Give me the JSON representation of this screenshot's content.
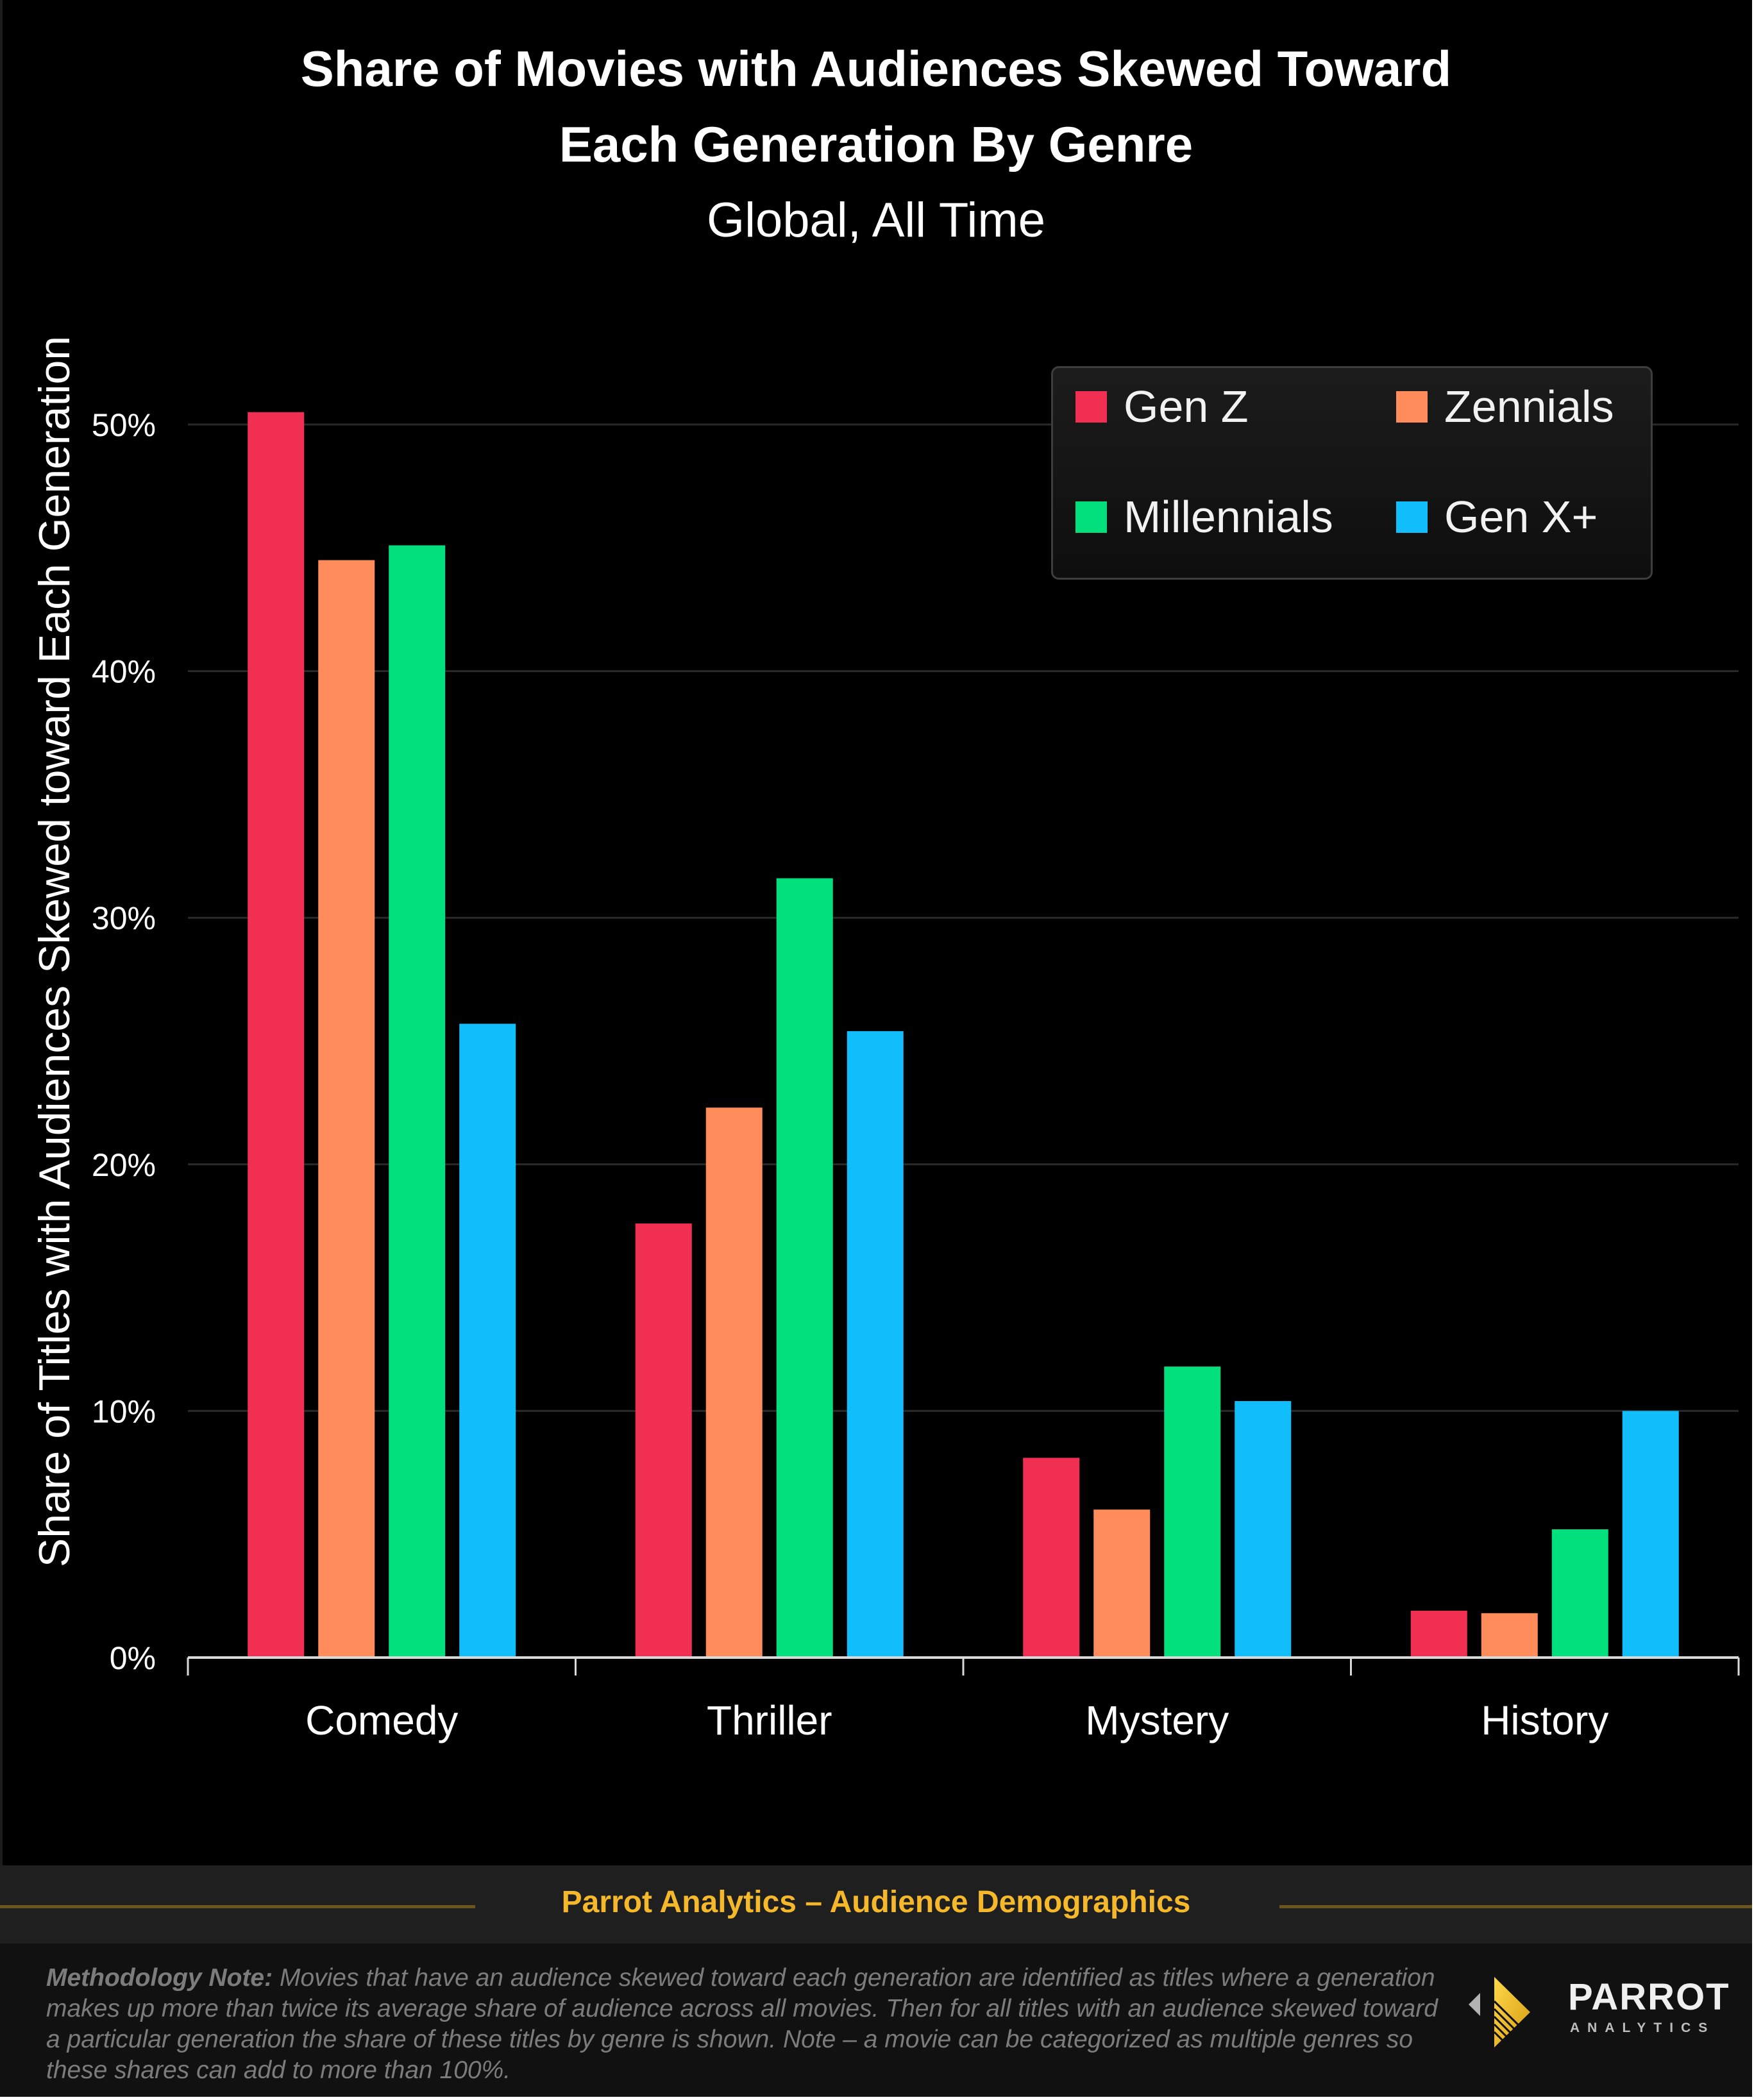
{
  "header": {
    "title_line1": "Share of Movies with Audiences Skewed Toward",
    "title_line2": "Each Generation By Genre",
    "subtitle": "Global, All Time"
  },
  "chart_data": {
    "type": "bar",
    "title": "Share of Movies with Audiences Skewed Toward Each Generation By Genre",
    "subtitle": "Global, All Time",
    "xlabel": "",
    "ylabel": "Share of Titles with Audiences Skewed toward Each Generation",
    "categories": [
      "Comedy",
      "Thriller",
      "Mystery",
      "History"
    ],
    "series": [
      {
        "name": "Gen Z",
        "color": "#f12f53",
        "values": [
          50.5,
          17.6,
          8.1,
          1.9
        ]
      },
      {
        "name": "Zennials",
        "color": "#ff8c5a",
        "values": [
          44.5,
          22.3,
          6.0,
          1.8
        ]
      },
      {
        "name": "Millennials",
        "color": "#02e07e",
        "values": [
          45.1,
          31.6,
          11.8,
          5.2
        ]
      },
      {
        "name": "Gen X+",
        "color": "#12bdfb",
        "values": [
          25.7,
          25.4,
          10.4,
          10.0
        ]
      }
    ],
    "ylim": [
      0,
      50
    ],
    "yticks": [
      0,
      10,
      20,
      30,
      40,
      50
    ],
    "ytick_labels": [
      "0%",
      "10%",
      "20%",
      "30%",
      "40%",
      "50%"
    ],
    "grid": true,
    "legend_position": "top-right",
    "unit": "%"
  },
  "legend": {
    "items": [
      {
        "label": "Gen Z",
        "color": "#f12f53"
      },
      {
        "label": "Zennials",
        "color": "#ff8c5a"
      },
      {
        "label": "Millennials",
        "color": "#02e07e"
      },
      {
        "label": "Gen X+",
        "color": "#12bdfb"
      }
    ]
  },
  "footer": {
    "band_title": "Parrot Analytics – Audience Demographics",
    "method_label": "Methodology Note:",
    "method_text": " Movies that have an audience skewed toward each generation are identified as titles where a generation makes up more than twice its average share of audience across all movies.  Then for all titles with an audience skewed toward a particular generation the share of these titles by genre is shown.  Note – a movie can be categorized as multiple genres so these shares can add to more than 100%.",
    "logo_word": "PARROT",
    "logo_sub": "ANALYTICS",
    "accent_color": "#f5b82a"
  }
}
